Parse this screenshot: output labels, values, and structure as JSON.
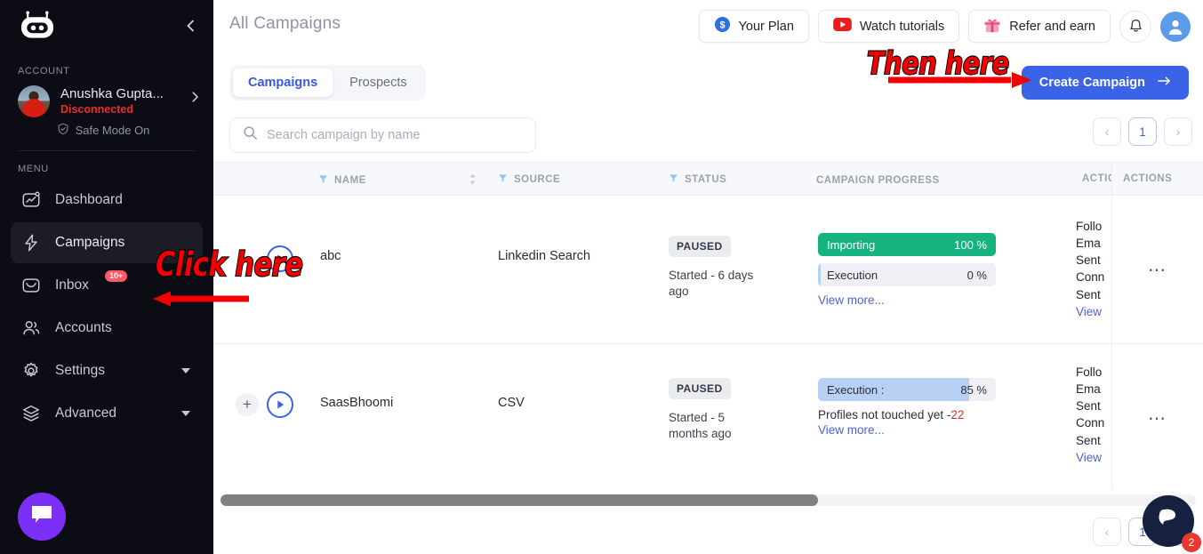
{
  "sidebar": {
    "logo_icon": "robot-logo",
    "collapse_icon": "chevron-left-icon",
    "account_label": "ACCOUNT",
    "account": {
      "name": "Anushka Gupta...",
      "status": "Disconnected",
      "safe_mode": "Safe Mode On",
      "safe_mode_icon": "shield-check-icon",
      "chevron_icon": "chevron-right-icon"
    },
    "menu_label": "MENU",
    "items": [
      {
        "label": "Dashboard",
        "icon": "dashboard-chart-icon",
        "active": false,
        "badge": "",
        "caret": false
      },
      {
        "label": "Campaigns",
        "icon": "lightning-bolt-icon",
        "active": true,
        "badge": "",
        "caret": false
      },
      {
        "label": "Inbox",
        "icon": "envelope-icon",
        "active": false,
        "badge": "10+",
        "caret": false
      },
      {
        "label": "Accounts",
        "icon": "users-icon",
        "active": false,
        "badge": "",
        "caret": false
      },
      {
        "label": "Settings",
        "icon": "gear-icon",
        "active": false,
        "badge": "",
        "caret": true
      },
      {
        "label": "Advanced",
        "icon": "layers-icon",
        "active": false,
        "badge": "",
        "caret": true
      }
    ],
    "chat_fab_icon": "chat-bubble-icon"
  },
  "header": {
    "title": "All Campaigns",
    "buttons": [
      {
        "label": "Your Plan",
        "icon": "dollar-coin-icon"
      },
      {
        "label": "Watch tutorials",
        "icon": "youtube-icon"
      },
      {
        "label": "Refer and earn",
        "icon": "gift-icon"
      }
    ],
    "bell_icon": "notification-bell-icon",
    "avatar_icon": "user-avatar-icon"
  },
  "tabs": [
    {
      "label": "Campaigns",
      "active": true
    },
    {
      "label": "Prospects",
      "active": false
    }
  ],
  "create_button": {
    "label": "Create Campaign",
    "icon": "arrow-right-icon"
  },
  "search": {
    "placeholder": "Search campaign by name",
    "value": "",
    "icon": "search-icon"
  },
  "pagination": {
    "prev": "‹",
    "page": "1",
    "next": "›"
  },
  "table": {
    "columns": [
      {
        "key": "name",
        "label": "NAME",
        "filter": true,
        "sortable": true
      },
      {
        "key": "source",
        "label": "SOURCE",
        "filter": true,
        "sortable": false
      },
      {
        "key": "status",
        "label": "STATUS",
        "filter": true,
        "sortable": false
      },
      {
        "key": "progress",
        "label": "CAMPAIGN PROGRESS",
        "filter": false,
        "sortable": true
      },
      {
        "key": "actions",
        "label": "ACTIONS",
        "filter": false,
        "sortable": false
      }
    ],
    "sticky_actions_label": "ACTIONS",
    "rows": [
      {
        "name": "abc",
        "source": "Linkedin Search",
        "status": "PAUSED",
        "started": "Started - 6 days ago",
        "has_expand": false,
        "play_icon": "play-circle-icon",
        "bars": [
          {
            "label": "Importing",
            "value": "100 %",
            "percent": 100,
            "color": "#16b27f",
            "text_color": "#ffffff"
          },
          {
            "label": "Execution",
            "value": "0 %",
            "percent": 0,
            "color": "#b9d0f5",
            "text_color": "#2b303b"
          }
        ],
        "not_touched": "",
        "not_touched_value": "",
        "view_more": "View more...",
        "actions_lines": [
          "Follo",
          "Ema",
          "Sent",
          "Conn",
          "Sent"
        ],
        "actions_view": "View",
        "menu_icon": "more-horizontal-icon"
      },
      {
        "name": "SaasBhoomi",
        "source": "CSV",
        "status": "PAUSED",
        "started": "Started - 5 months ago",
        "has_expand": true,
        "expand_icon": "plus-icon",
        "play_icon": "play-circle-icon",
        "bars": [
          {
            "label": "Execution :",
            "value": "85 %",
            "percent": 85,
            "color": "#b9d0f5",
            "text_color": "#2b303b"
          }
        ],
        "not_touched": "Profiles not touched yet -",
        "not_touched_value": "22",
        "view_more": "View more...",
        "actions_lines": [
          "Follo",
          "Ema",
          "Sent",
          "Conn",
          "Sent"
        ],
        "actions_view": "View",
        "menu_icon": "more-horizontal-icon"
      }
    ]
  },
  "bottom_pagination": {
    "prev": "‹",
    "page": "1",
    "next": "›"
  },
  "annotations": {
    "click_here": "Click here",
    "then_here": "Then here"
  },
  "chat_widget": {
    "icon": "chat-support-icon",
    "badge": "2"
  },
  "colors": {
    "accent_blue": "#3b63e8",
    "green": "#16b27f",
    "light_blue": "#b9d0f5",
    "red": "#ee2b2b",
    "sidebar_bg": "#0c0c14",
    "annotation_red": "#f10000"
  }
}
